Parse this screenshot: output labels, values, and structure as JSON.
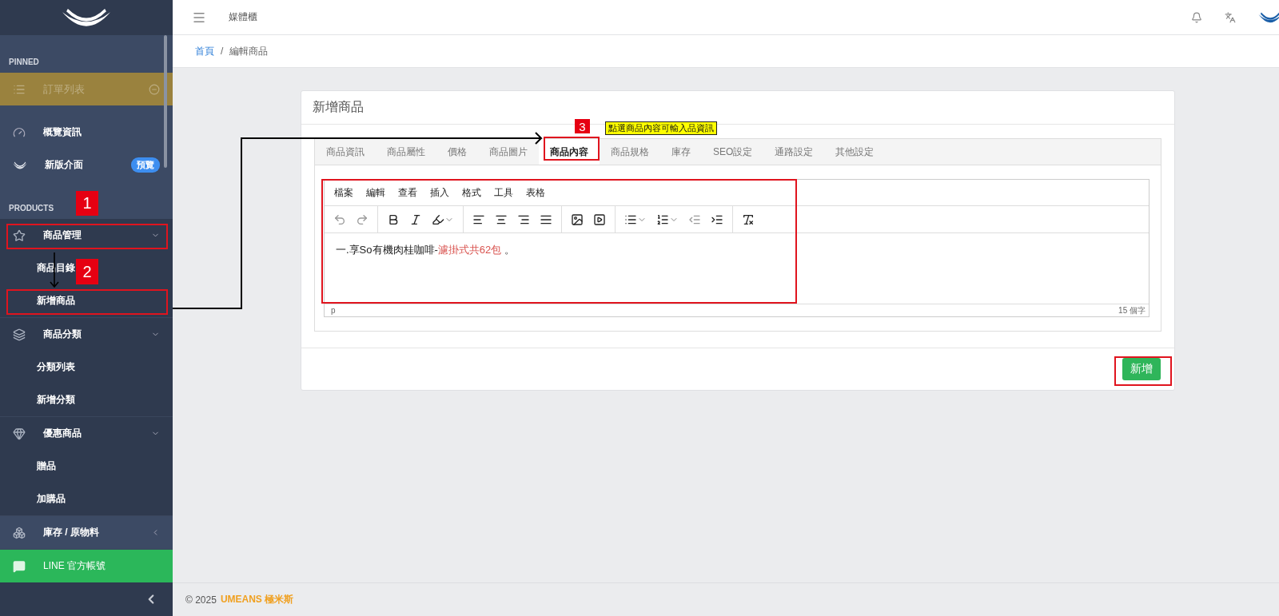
{
  "sidebar": {
    "pinned": {
      "heading": "PINNED",
      "items": [
        {
          "label": "訂單列表"
        }
      ]
    },
    "menu": [
      {
        "label": "概覽資訊"
      },
      {
        "label": "新版介面",
        "badge": "預覽"
      }
    ],
    "products": {
      "heading": "PRODUCTS",
      "groups": [
        {
          "label": "商品管理",
          "expanded": true,
          "children": [
            {
              "label": "商品目錄"
            },
            {
              "label": "新增商品"
            }
          ]
        },
        {
          "label": "商品分類",
          "expanded": true,
          "children": [
            {
              "label": "分類列表"
            },
            {
              "label": "新增分類"
            }
          ]
        },
        {
          "label": "優惠商品",
          "expanded": true,
          "children": [
            {
              "label": "贈品"
            },
            {
              "label": "加購品"
            }
          ]
        },
        {
          "label": "庫存 / 原物料",
          "expanded": false
        }
      ]
    },
    "line_item": {
      "label": "LINE 官方帳號"
    }
  },
  "header": {
    "title": "媒體櫃"
  },
  "breadcrumb": {
    "separator": "/",
    "items": [
      {
        "label": "首頁",
        "kind": "link"
      },
      {
        "label": "編輯商品",
        "kind": "current"
      }
    ]
  },
  "card": {
    "title": "新增商品",
    "tabs": [
      {
        "label": "商品資訊",
        "selected": false
      },
      {
        "label": "商品屬性",
        "selected": false
      },
      {
        "label": "價格",
        "selected": false
      },
      {
        "label": "商品圖片",
        "selected": false
      },
      {
        "label": "商品內容",
        "selected": true
      },
      {
        "label": "商品規格",
        "selected": false
      },
      {
        "label": "庫存",
        "selected": false
      },
      {
        "label": "SEO設定",
        "selected": false
      },
      {
        "label": "通路設定",
        "selected": false
      },
      {
        "label": "其他設定",
        "selected": false
      }
    ],
    "editor": {
      "menus": [
        "檔案",
        "編輯",
        "查看",
        "插入",
        "格式",
        "工具",
        "表格"
      ],
      "toolbar": [
        [
          {
            "kind": "undo",
            "disabled": true
          },
          {
            "kind": "redo",
            "disabled": true
          }
        ],
        [
          {
            "kind": "bold",
            "disabled": false
          },
          {
            "kind": "italic",
            "disabled": false
          },
          {
            "kind": "highlight",
            "disabled": false
          }
        ],
        [
          {
            "kind": "align-left",
            "disabled": false
          },
          {
            "kind": "align-center",
            "disabled": false
          },
          {
            "kind": "align-right",
            "disabled": false
          },
          {
            "kind": "align-justify",
            "disabled": false
          }
        ],
        [
          {
            "kind": "image",
            "disabled": false
          },
          {
            "kind": "media",
            "disabled": false
          }
        ],
        [
          {
            "kind": "bullets",
            "disabled": false
          },
          {
            "kind": "numbers",
            "disabled": false
          },
          {
            "kind": "outdent",
            "disabled": true
          },
          {
            "kind": "indent",
            "disabled": false
          }
        ],
        [
          {
            "kind": "clear-format",
            "disabled": false
          }
        ]
      ],
      "content": [
        {
          "text": "一.享So有機肉桂咖啡-",
          "kind": "plain"
        },
        {
          "text": "濾掛式共62包",
          "kind": "highlight"
        },
        {
          "text": " 。",
          "kind": "plain"
        }
      ],
      "status_path": "p",
      "word_count": "15 個字"
    },
    "submit": "新增"
  },
  "footer": {
    "copyright": "© 2025",
    "brand": "UMEANS 極米斯"
  },
  "annotations": {
    "steps": [
      {
        "number": "1"
      },
      {
        "number": "2"
      },
      {
        "number": "3"
      }
    ],
    "callout": "點選商品內容可輸入品資訊"
  }
}
